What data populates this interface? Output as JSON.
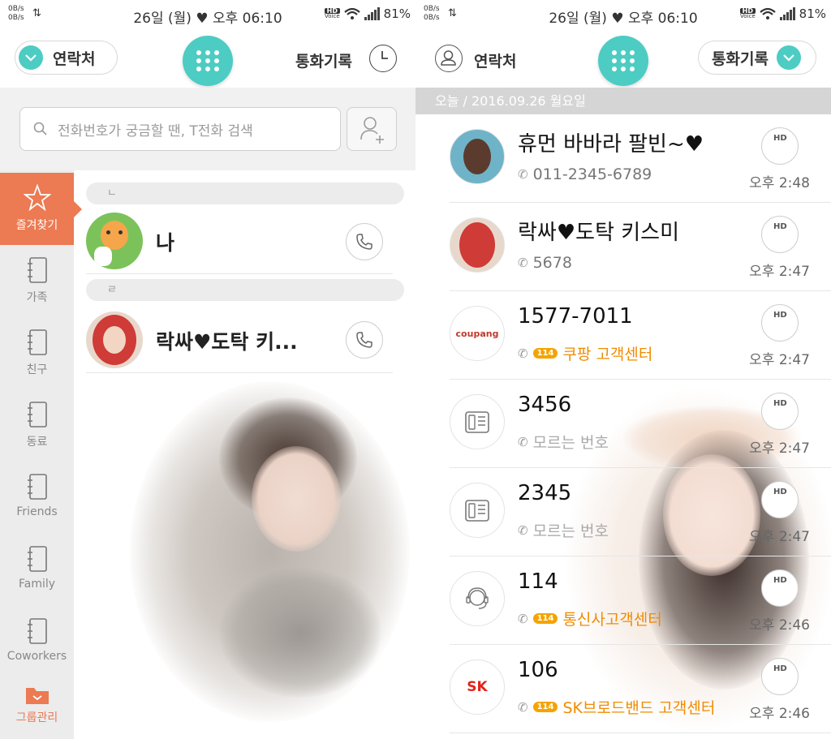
{
  "status_bar": {
    "net_up": "0B/s",
    "net_down": "0B/s",
    "datetime": "26일 (월) ♥ 오후 06:10",
    "battery": "81%",
    "hd_label": "HD",
    "voice_label": "Voice"
  },
  "left": {
    "tab_contacts": "연락처",
    "tab_call_log": "통화기록",
    "search_placeholder": "전화번호가 궁금할 땐, T전화 검색",
    "sidebar": [
      {
        "label": "즐겨찾기",
        "icon": "star-icon",
        "active": true
      },
      {
        "label": "가족",
        "icon": "notebook-icon"
      },
      {
        "label": "친구",
        "icon": "notebook-icon"
      },
      {
        "label": "동료",
        "icon": "notebook-icon"
      },
      {
        "label": "Friends",
        "icon": "notebook-icon"
      },
      {
        "label": "Family",
        "icon": "notebook-icon"
      },
      {
        "label": "Coworkers",
        "icon": "notebook-icon"
      },
      {
        "label": "그룹관리",
        "icon": "folder-icon"
      }
    ],
    "groups": [
      {
        "header": "ㄴ",
        "contacts": [
          {
            "name": "나"
          }
        ]
      },
      {
        "header": "ㄹ",
        "contacts": [
          {
            "name": "락싸♥도탁 키..."
          }
        ]
      }
    ]
  },
  "right": {
    "tab_contacts": "연락처",
    "tab_call_log": "통화기록",
    "date_header": "오늘 / 2016.09.26 월요일",
    "call_button_label": "HD",
    "calls": [
      {
        "name": "휴먼 바바라 팔빈~♥",
        "sub": "011-2345-6789",
        "sub_type": "number",
        "time": "오후 2:48"
      },
      {
        "name": "락싸♥도탁 키스미",
        "sub": "5678",
        "sub_type": "number",
        "time": "오후 2:47"
      },
      {
        "name": "1577-7011",
        "sub": "쿠팡 고객센터",
        "sub_type": "info",
        "badge": "114",
        "avatar_text": "coupang",
        "time": "오후 2:47"
      },
      {
        "name": "3456",
        "sub": "모르는 번호",
        "sub_type": "unknown",
        "time": "오후 2:47"
      },
      {
        "name": "2345",
        "sub": "모르는 번호",
        "sub_type": "unknown",
        "time": "오후 2:47"
      },
      {
        "name": "114",
        "sub": "통신사고객센터",
        "sub_type": "info",
        "badge": "114",
        "time": "오후 2:46"
      },
      {
        "name": "106",
        "sub": "SK브로드밴드 고객센터",
        "sub_type": "info",
        "badge": "114",
        "avatar_text": "SK",
        "time": "오후 2:46"
      }
    ]
  }
}
